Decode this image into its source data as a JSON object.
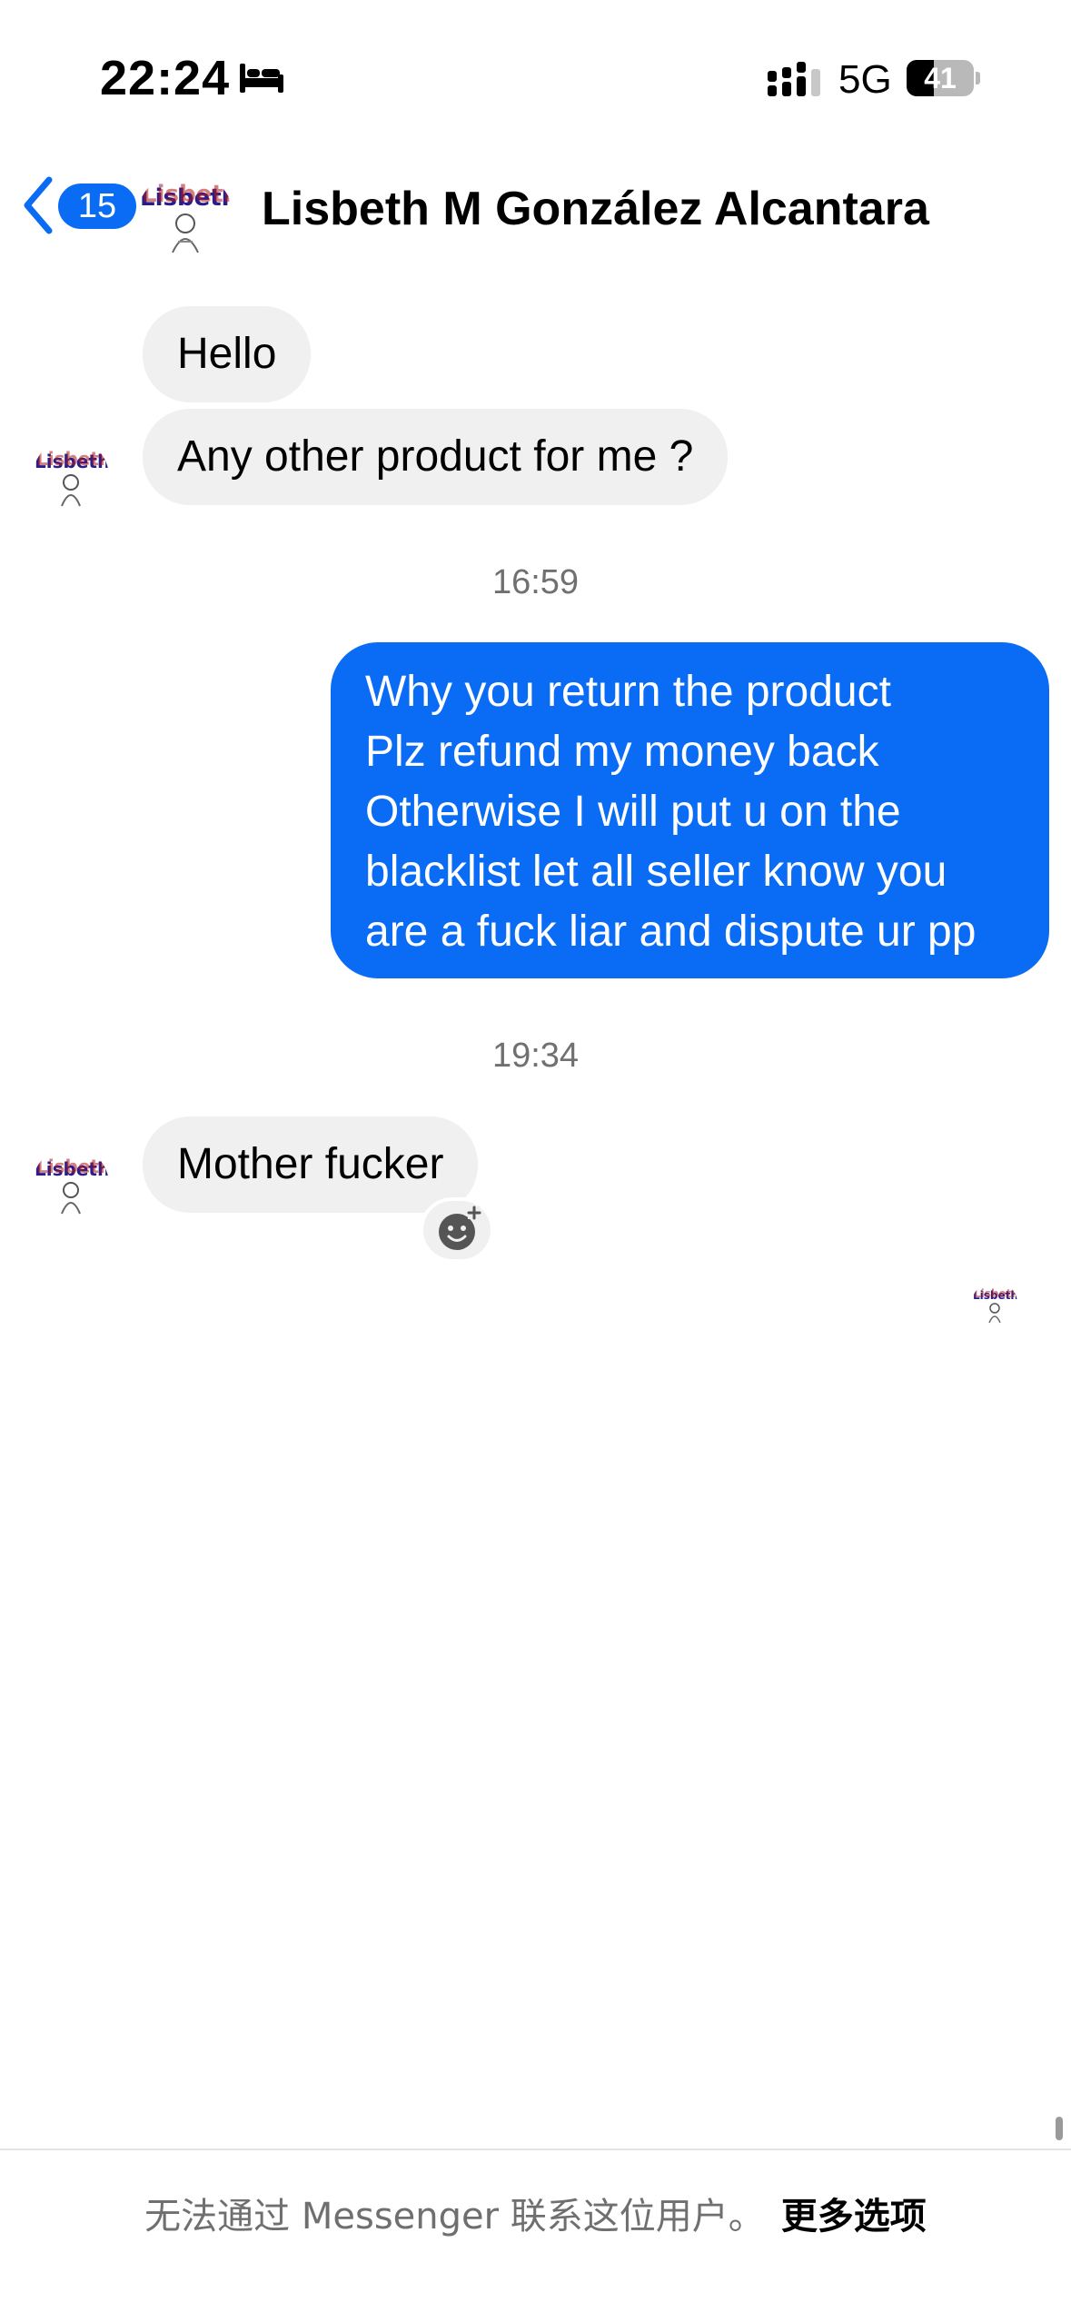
{
  "status_bar": {
    "time": "22:24",
    "network": "5G",
    "battery": "41",
    "battery_level": 0.41,
    "icons": [
      "bed-icon",
      "signal-icon",
      "battery-icon"
    ]
  },
  "header": {
    "back_badge": "15",
    "contact_name": "Lisbeth M González Alcantara",
    "avatar_caption": "Lisbeth"
  },
  "messages": [
    {
      "direction": "incoming",
      "text": "Hello"
    },
    {
      "direction": "incoming",
      "text": "Any other product for me ?"
    },
    {
      "direction": "timestamp",
      "text": "16:59"
    },
    {
      "direction": "outgoing",
      "lines": [
        "Why you return the product",
        "Plz refund my money back",
        "Otherwise I will put u on the",
        "blacklist let all seller know you",
        "are a fuck liar and dispute ur pp"
      ]
    },
    {
      "direction": "timestamp",
      "text": "19:34"
    },
    {
      "direction": "incoming",
      "text": "Mother fucker"
    }
  ],
  "footer": {
    "notice": "无法通过 Messenger 联系这位用户。",
    "more_options": "更多选项"
  },
  "colors": {
    "accent": "#0a6cf5",
    "incoming_bubble": "#f0f0f0",
    "timestamp_text": "#707070",
    "footer_text": "#6f6f6f"
  }
}
